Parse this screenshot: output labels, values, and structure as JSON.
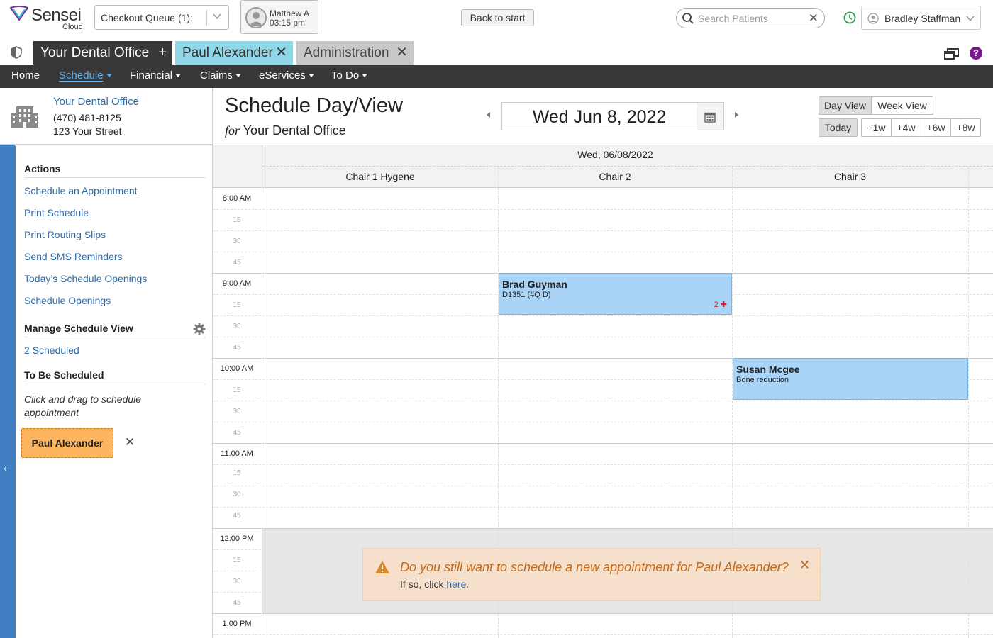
{
  "brand": {
    "name": "Sensei",
    "sub": "Cloud"
  },
  "topbar": {
    "checkout_label": "Checkout Queue (1):",
    "user_card": {
      "name": "Matthew A",
      "time": "03:15 pm"
    },
    "back_button": "Back to start",
    "search_placeholder": "Search Patients",
    "search_clear": "✕",
    "current_user": "Bradley Staffman"
  },
  "tabs": [
    {
      "label": "Your Dental Office",
      "action": "+"
    },
    {
      "label": "Paul Alexander",
      "action": "✕"
    },
    {
      "label": "Administration",
      "action": "✕"
    }
  ],
  "help_label": "?",
  "nav": [
    {
      "label": "Home"
    },
    {
      "label": "Schedule"
    },
    {
      "label": "Financial"
    },
    {
      "label": "Claims"
    },
    {
      "label": "eServices"
    },
    {
      "label": "To Do"
    }
  ],
  "office": {
    "name": "Your Dental Office",
    "phone": "(470) 481-8125",
    "address": "123 Your Street"
  },
  "sidebar": {
    "actions_title": "Actions",
    "actions": [
      "Schedule an Appointment",
      "Print Schedule",
      "Print Routing Slips",
      "Send SMS Reminders",
      "Today’s Schedule Openings",
      "Schedule Openings"
    ],
    "manage_title": "Manage Schedule View",
    "scheduled_link": "2 Scheduled",
    "tbs_title": "To Be Scheduled",
    "hint": "Click and drag to schedule appointment",
    "pending_patient": "Paul Alexander",
    "pending_remove": "✕",
    "collapse_arrow": "‹"
  },
  "schedule": {
    "title": "Schedule Day/View",
    "for_word": "for",
    "for_office": "Your Dental Office",
    "date": "Wed Jun 8, 2022",
    "view_buttons": [
      "Day View",
      "Week View"
    ],
    "jump_buttons": [
      "Today",
      "+1w",
      "+4w",
      "+6w",
      "+8w"
    ],
    "grid_date": "Wed, 06/08/2022",
    "chairs": [
      "Chair 1 Hygene",
      "Chair 2",
      "Chair 3"
    ],
    "hours": [
      "8:00 AM",
      "9:00 AM",
      "10:00 AM",
      "11:00 AM",
      "12:00 PM",
      "1:00 PM"
    ],
    "minutes": [
      "15",
      "30",
      "45"
    ],
    "appointments": [
      {
        "patient": "Brad Guyman",
        "procedure": "D1351 (#Q D)",
        "flag": "2 ✚",
        "chair": "Chair 2",
        "start": "9:00 AM",
        "duration_min": 30
      },
      {
        "patient": "Susan Mcgee",
        "procedure": "Bone reduction",
        "flag": "",
        "chair": "Chair 3",
        "start": "10:00 AM",
        "duration_min": 30
      }
    ]
  },
  "alert": {
    "message": "Do you still want to schedule a new appointment for Paul Alexander?",
    "sub_prefix": "If so, click",
    "sub_link": "here.",
    "close": "✕"
  },
  "colors": {
    "accent_blue": "#3f7ec1",
    "link": "#2f6aa8",
    "appointment": "#aad4f7",
    "pending": "#fdb45e",
    "alert_bg": "#f6dfcb",
    "patient_tab": "#8fd6e6",
    "help": "#7b1a8c"
  }
}
